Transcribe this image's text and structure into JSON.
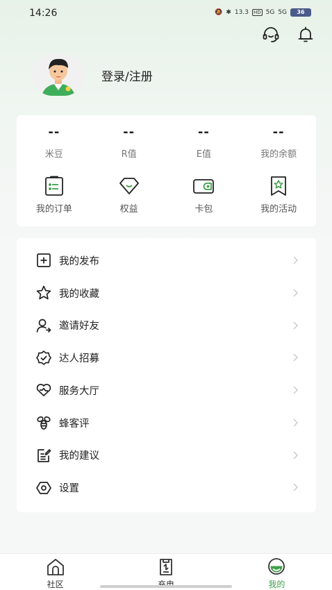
{
  "status_bar": {
    "time": "14:26",
    "speed": "13.3",
    "hd": "HD",
    "net1": "5G",
    "net2": "5G",
    "battery": "36"
  },
  "top_actions": {
    "icons": [
      "headset-icon",
      "bell-icon"
    ]
  },
  "profile": {
    "login_label": "登录/注册"
  },
  "stats": [
    {
      "value": "--",
      "label": "米豆"
    },
    {
      "value": "--",
      "label": "R值"
    },
    {
      "value": "--",
      "label": "E值"
    },
    {
      "value": "--",
      "label": "我的余额"
    }
  ],
  "shortcuts": [
    {
      "label": "我的订单",
      "icon": "order-clipboard-icon"
    },
    {
      "label": "权益",
      "icon": "rights-diamond-icon"
    },
    {
      "label": "卡包",
      "icon": "card-wallet-icon"
    },
    {
      "label": "我的活动",
      "icon": "activity-bookmark-icon"
    }
  ],
  "menu": [
    {
      "label": "我的发布",
      "icon": "publish-icon"
    },
    {
      "label": "我的收藏",
      "icon": "star-icon"
    },
    {
      "label": "邀请好友",
      "icon": "invite-user-icon"
    },
    {
      "label": "达人招募",
      "icon": "badge-icon"
    },
    {
      "label": "服务大厅",
      "icon": "heart-handshake-icon"
    },
    {
      "label": "蜂客评",
      "icon": "bee-icon"
    },
    {
      "label": "我的建议",
      "icon": "suggestion-icon"
    },
    {
      "label": "设置",
      "icon": "settings-icon"
    }
  ],
  "tabs": [
    {
      "label": "社区",
      "icon": "community-house-icon",
      "active": false
    },
    {
      "label": "充电",
      "icon": "charging-icon",
      "active": false
    },
    {
      "label": "我的",
      "icon": "profile-face-icon",
      "active": true
    }
  ],
  "colors": {
    "accent": "#3fa04a",
    "icon_stroke": "#222222",
    "shortcut_accent": "#3fa04a"
  }
}
